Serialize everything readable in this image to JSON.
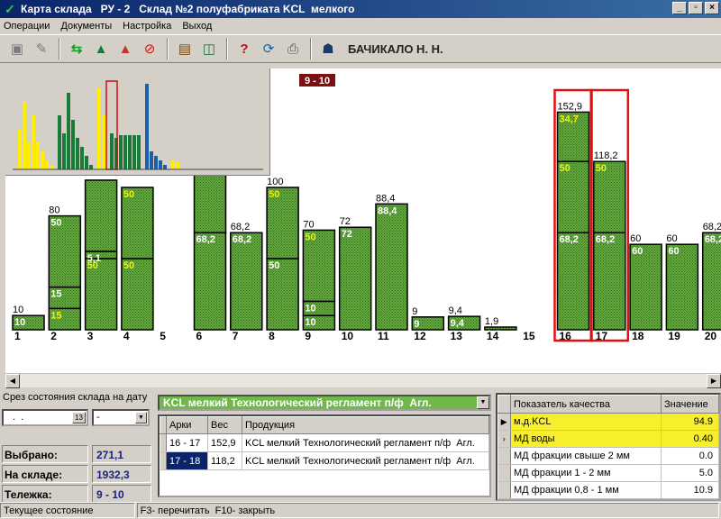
{
  "window": {
    "title": "Карта склада   РУ - 2   Склад №2 полуфабриката KCL  мелкого",
    "controls": [
      "_",
      "▫",
      "×"
    ]
  },
  "menu": [
    "Операции",
    "Документы",
    "Настройка",
    "Выход"
  ],
  "toolbar": {
    "icons": [
      "floppy-disk-icon",
      "edit-icon",
      "swap-arrows-icon",
      "pile-icon",
      "pile-red-icon",
      "no-entry-icon",
      "book-icon",
      "door-icon",
      "help-icon",
      "refresh-icon",
      "printer-icon",
      "user-icon"
    ],
    "user": "БАЧИКАЛО Н. Н."
  },
  "chart": {
    "selection_label": "9 - 10",
    "colors": {
      "bar": "#6db045",
      "border": "#000000",
      "selected": "#e01010",
      "white_text": "#ffffff",
      "yellow_text": "#f2f20a"
    }
  },
  "chart_data": {
    "type": "bar",
    "categories": [
      "1",
      "2",
      "3",
      "4",
      "5",
      "6",
      "7",
      "8",
      "9",
      "10",
      "11",
      "12",
      "13",
      "14",
      "15",
      "16",
      "17",
      "18",
      "19",
      "20"
    ],
    "totals": [
      "10",
      "80",
      "",
      "",
      "",
      "",
      "68,2",
      "100",
      "70",
      "72",
      "88,4",
      "9",
      "9,4",
      "1,9",
      "",
      "152,9",
      "118,2",
      "60",
      "60",
      "68,2"
    ],
    "segments": [
      [
        {
          "value": 10,
          "label": "10",
          "color": "white"
        }
      ],
      [
        {
          "value": 15,
          "label": "15",
          "color": "yellow"
        },
        {
          "value": 15,
          "label": "15",
          "color": "white"
        },
        {
          "value": 50,
          "label": "50",
          "color": "white"
        }
      ],
      [
        {
          "value": 50,
          "label": "50",
          "color": "yellow"
        },
        {
          "value": 5.1,
          "label": "5,1",
          "color": "white"
        },
        {
          "value": 50,
          "label": "",
          "color": "white"
        }
      ],
      [
        {
          "value": 50,
          "label": "50",
          "color": "yellow"
        },
        {
          "value": 50,
          "label": "50",
          "color": "yellow"
        }
      ],
      [],
      [
        {
          "value": 68.2,
          "label": "68,2",
          "color": "white"
        },
        {
          "value": 50,
          "label": "",
          "color": "white"
        }
      ],
      [
        {
          "value": 68.2,
          "label": "68,2",
          "color": "white"
        }
      ],
      [
        {
          "value": 50,
          "label": "50",
          "color": "white"
        },
        {
          "value": 50,
          "label": "50",
          "color": "yellow"
        }
      ],
      [
        {
          "value": 10,
          "label": "10",
          "color": "white"
        },
        {
          "value": 10,
          "label": "10",
          "color": "white"
        },
        {
          "value": 50,
          "label": "50",
          "color": "yellow"
        }
      ],
      [
        {
          "value": 72,
          "label": "72",
          "color": "white"
        }
      ],
      [
        {
          "value": 88.4,
          "label": "88,4",
          "color": "white"
        }
      ],
      [
        {
          "value": 9,
          "label": "9",
          "color": "white"
        }
      ],
      [
        {
          "value": 9.4,
          "label": "9,4",
          "color": "white"
        }
      ],
      [
        {
          "value": 1.9,
          "label": "1,9",
          "color": "white"
        }
      ],
      [],
      [
        {
          "value": 68.2,
          "label": "68,2",
          "color": "white"
        },
        {
          "value": 50,
          "label": "50",
          "color": "yellow"
        },
        {
          "value": 34.7,
          "label": "34,7",
          "color": "yellow"
        }
      ],
      [
        {
          "value": 68.2,
          "label": "68,2",
          "color": "white"
        },
        {
          "value": 50,
          "label": "50",
          "color": "yellow"
        }
      ],
      [
        {
          "value": 60,
          "label": "60",
          "color": "white"
        }
      ],
      [
        {
          "value": 60,
          "label": "60",
          "color": "white"
        }
      ],
      [
        {
          "value": 68.2,
          "label": "68,2",
          "color": "white"
        }
      ]
    ],
    "selected": [
      "16",
      "17"
    ]
  },
  "overview": {
    "groups": [
      {
        "color": "#ffee00",
        "values": [
          0.45,
          0.75,
          0.3,
          0.6,
          0.3,
          0.2,
          0.1,
          0.05
        ]
      },
      {
        "color": "#1a7a3a",
        "values": [
          0.6,
          0.4,
          0.85,
          0.55,
          0.35,
          0.25,
          0.15,
          0.05
        ]
      },
      {
        "color": "#ffee00",
        "values": [
          0.9,
          0.6
        ]
      },
      {
        "color": "#1a7a3a",
        "values": [
          0.4,
          0.35,
          0.38,
          0.38,
          0.38,
          0.38,
          0.38
        ]
      },
      {
        "color": "#1a5fa8",
        "values": [
          0.95,
          0.2,
          0.15,
          0.1,
          0.05
        ]
      },
      {
        "color": "#ffee00",
        "values": [
          0.1,
          0.08
        ]
      }
    ]
  },
  "left_panel": {
    "title": "Срез состояния склада на дату",
    "date_value": "  .  .",
    "shift_value": "-",
    "stats": [
      {
        "label": "Выбрано:",
        "value": "271,1"
      },
      {
        "label": "На складе:",
        "value": "1932,3"
      },
      {
        "label": "Тележка:",
        "value": "9 - 10"
      }
    ]
  },
  "product_combo": "KCL мелкий Технологический регламент п/ф  Агл.",
  "stock_table": {
    "headers": [
      "Арки",
      "Вес",
      "Продукция"
    ],
    "rows": [
      [
        "16 - 17",
        "152,9",
        "KCL мелкий Технологический регламент п/ф  Агл."
      ],
      [
        "17 - 18",
        "118,2",
        "KCL мелкий Технологический регламент п/ф  Агл."
      ]
    ]
  },
  "quality_table": {
    "headers": [
      "Показатель качества",
      "Значение"
    ],
    "rows": [
      [
        "м.д.KCL",
        "94.9"
      ],
      [
        "МД воды",
        "0.40"
      ],
      [
        "МД фракции свыше 2 мм",
        "0.0"
      ],
      [
        "МД фракции 1 - 2 мм",
        "5.0"
      ],
      [
        "МД фракции 0,8 - 1 мм",
        "10.9"
      ]
    ]
  },
  "status_bar": [
    "Текущее состояние",
    "F3- перечитать  F10- закрыть"
  ]
}
